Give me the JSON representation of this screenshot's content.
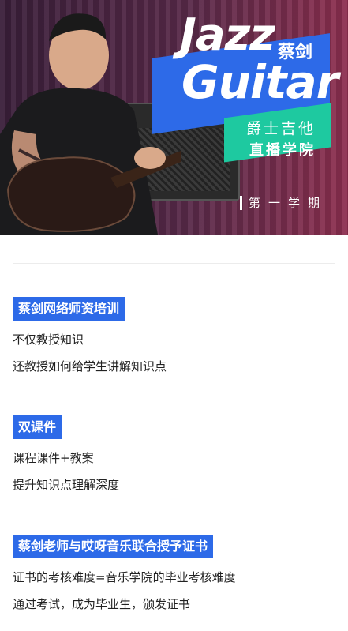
{
  "hero": {
    "title_word1": "Jazz",
    "title_word2": "Guitar",
    "teacher_name": "蔡剑",
    "subtitle_line1": "爵士吉他",
    "subtitle_line2": "直播学院",
    "term": "第一学期",
    "colors": {
      "blue": "#2d6ae8",
      "green": "#1ec9a0",
      "background": "#5a2a4a"
    }
  },
  "sections": [
    {
      "heading": "蔡剑网络师资培训",
      "lines": [
        "不仅教授知识",
        "还教授如何给学生讲解知识点"
      ]
    },
    {
      "heading": "双课件",
      "lines": [
        "课程课件+教案",
        "提升知识点理解深度"
      ]
    },
    {
      "heading": "蔡剑老师与哎呀音乐联合授予证书",
      "lines": [
        "证书的考核难度=音乐学院的毕业考核难度",
        "通过考试，成为毕业生，颁发证书"
      ]
    }
  ]
}
